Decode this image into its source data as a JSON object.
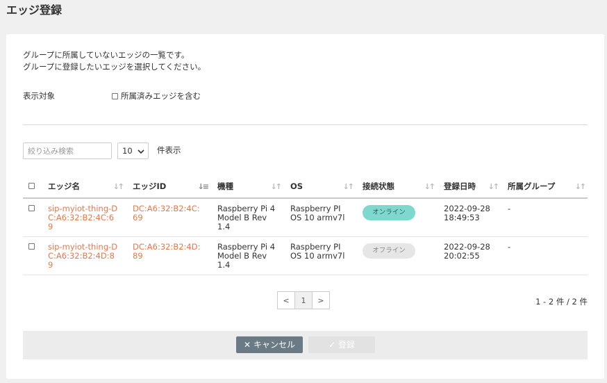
{
  "page": {
    "title": "エッジ登録"
  },
  "description": {
    "line1": "グループに所属していないエッジの一覧です。",
    "line2": "グループに登録したいエッジを選択してください。"
  },
  "filter": {
    "label": "表示対象",
    "include_assigned_label": "所属済みエッジを含む"
  },
  "search": {
    "placeholder": "絞り込み検索"
  },
  "page_size": {
    "value": "10",
    "suffix": "件表示"
  },
  "table": {
    "columns": [
      "エッジ名",
      "エッジID",
      "機種",
      "OS",
      "接続状態",
      "登録日時",
      "所属グループ"
    ],
    "rows": [
      {
        "name": "sip-myiot-thing-DC:A6:32:B2:4C:69",
        "id": "DC:A6:32:B2:4C:69",
        "model": "Raspberry Pi 4 Model B Rev 1.4",
        "os": "Raspberry PI OS 10 armv7l",
        "status": "オンライン",
        "date": "2022-09-28",
        "time": "18:49:53",
        "group": "-"
      },
      {
        "name": "sip-myiot-thing-DC:A6:32:B2:4D:89",
        "id": "DC:A6:32:B2:4D:89",
        "model": "Raspberry Pi 4 Model B Rev 1.4",
        "os": "Raspberry PI OS 10 armv7l",
        "status": "オフライン",
        "date": "2022-09-28",
        "time": "20:02:55",
        "group": "-"
      }
    ]
  },
  "pagination": {
    "prev": "<",
    "current": "1",
    "next": ">",
    "summary": "1 - 2 件 / 2 件"
  },
  "actions": {
    "cancel_label": "キャンセル",
    "register_label": "登録"
  },
  "colors": {
    "accent_text": "#e8784a",
    "online": "#7fd8ce",
    "offline": "#e6e6e6",
    "cancel_button": "#6b7b86"
  },
  "icons": {
    "cancel": "close-icon",
    "register": "check-icon",
    "sort": "sort-icon"
  }
}
